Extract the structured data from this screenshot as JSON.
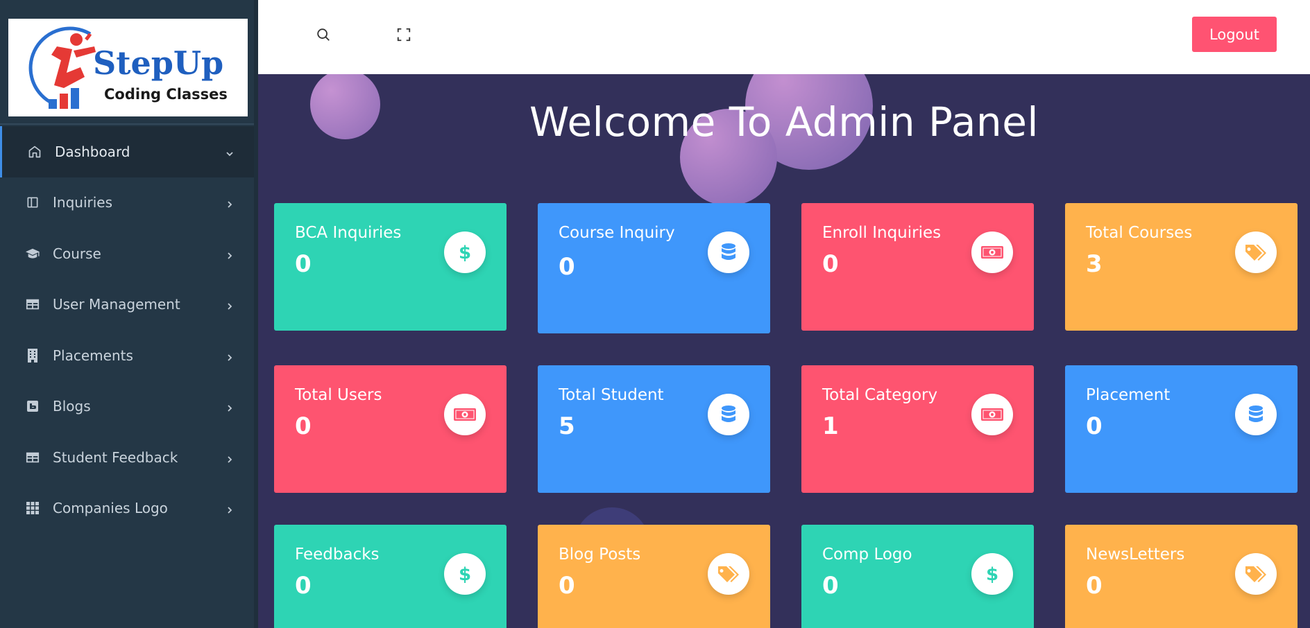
{
  "brand": {
    "name": "StepUp",
    "tagline": "Coding Classes",
    "colors": {
      "primary": "#1f5fbf",
      "accent": "#e53935"
    }
  },
  "header": {
    "search_icon": "search-icon",
    "fullscreen_icon": "fullscreen-icon",
    "logout_label": "Logout",
    "logout_color": "#ff5372"
  },
  "sidebar": {
    "items": [
      {
        "label": "Dashboard",
        "icon": "home-icon",
        "active": true,
        "chevron": "chevron-down-icon"
      },
      {
        "label": "Inquiries",
        "icon": "panel-icon",
        "chevron": "chevron-right-icon"
      },
      {
        "label": "Course",
        "icon": "graduation-cap-icon",
        "chevron": "chevron-right-icon"
      },
      {
        "label": "User Management",
        "icon": "table-icon",
        "chevron": "chevron-right-icon"
      },
      {
        "label": "Placements",
        "icon": "building-icon",
        "chevron": "chevron-right-icon"
      },
      {
        "label": "Blogs",
        "icon": "blog-icon",
        "chevron": "chevron-right-icon"
      },
      {
        "label": "Student Feedback",
        "icon": "table-icon",
        "chevron": "chevron-right-icon"
      },
      {
        "label": "Companies Logo",
        "icon": "grid-icon",
        "chevron": "chevron-right-icon"
      }
    ]
  },
  "main": {
    "title": "Welcome To Admin Panel",
    "cards": [
      {
        "title": "BCA Inquiries",
        "value": "0",
        "color": "green",
        "icon": "dollar-icon"
      },
      {
        "title": "Course Inquiry",
        "value": "0",
        "color": "blue",
        "icon": "database-icon"
      },
      {
        "title": "Enroll Inquiries",
        "value": "0",
        "color": "red",
        "icon": "money-bill-icon"
      },
      {
        "title": "Total Courses",
        "value": "3",
        "color": "orange",
        "icon": "tags-icon"
      },
      {
        "title": "Total Users",
        "value": "0",
        "color": "red",
        "icon": "money-bill-icon"
      },
      {
        "title": "Total Student",
        "value": "5",
        "color": "blue",
        "icon": "database-icon"
      },
      {
        "title": "Total Category",
        "value": "1",
        "color": "red",
        "icon": "money-bill-icon"
      },
      {
        "title": "Placement",
        "value": "0",
        "color": "blue",
        "icon": "database-icon"
      },
      {
        "title": "Feedbacks",
        "value": "0",
        "color": "green",
        "icon": "dollar-icon"
      },
      {
        "title": "Blog Posts",
        "value": "0",
        "color": "orange",
        "icon": "tags-icon"
      },
      {
        "title": "Comp Logo",
        "value": "0",
        "color": "green",
        "icon": "dollar-icon"
      },
      {
        "title": "NewsLetters",
        "value": "0",
        "color": "orange",
        "icon": "tags-icon"
      }
    ],
    "card_colors": {
      "green": "#2ed4b4",
      "blue": "#3f97fb",
      "red": "#fe5470",
      "orange": "#ffb24c"
    }
  }
}
